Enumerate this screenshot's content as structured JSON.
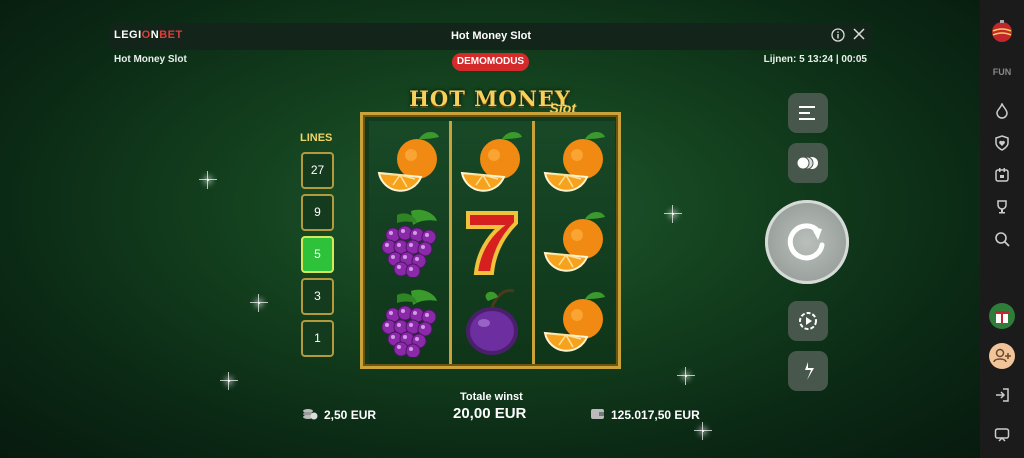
{
  "header": {
    "brand": {
      "pre": "LEGI",
      "o": "O",
      "mid": "N",
      "bet": "BET"
    },
    "title": "Hot Money Slot",
    "info_icon": "info-icon",
    "close_icon": "close-icon"
  },
  "subheader": {
    "game_name": "Hot Money Slot",
    "badge": "DEMOMODUS",
    "status": "Lijnen: 5  13:24 | 00:05"
  },
  "game_logo": {
    "main": "HOT MONEY",
    "sub": "Slot"
  },
  "lines": {
    "label": "LINES",
    "options": [
      "27",
      "9",
      "5",
      "3",
      "1"
    ],
    "selected": "5"
  },
  "reels": [
    [
      "orange",
      "grapes",
      "grapes"
    ],
    [
      "orange",
      "seven",
      "plum"
    ],
    [
      "orange",
      "orange",
      "orange"
    ]
  ],
  "footer": {
    "bet": "2,50 EUR",
    "win_label": "Totale winst",
    "win_value": "20,00 EUR",
    "balance": "125.017,50 EUR"
  },
  "controls": {
    "menu_icon": "menu-icon",
    "coins_icon": "coins-icon",
    "spin_icon": "spin-icon",
    "autoplay_icon": "autoplay-icon",
    "turbo_icon": "turbo-icon"
  },
  "rail": {
    "fun_label": "FUN",
    "icons": [
      "ornament-icon",
      "flame-icon",
      "shield-heart-icon",
      "calendar-icon",
      "trophy-icon",
      "search-icon",
      "gift-avatar-icon",
      "add-user-icon",
      "login-icon",
      "chat-icon"
    ]
  },
  "colors": {
    "accent_red": "#d52a2a",
    "gold": "#c9a23a",
    "active_line": "#2ec23a"
  }
}
